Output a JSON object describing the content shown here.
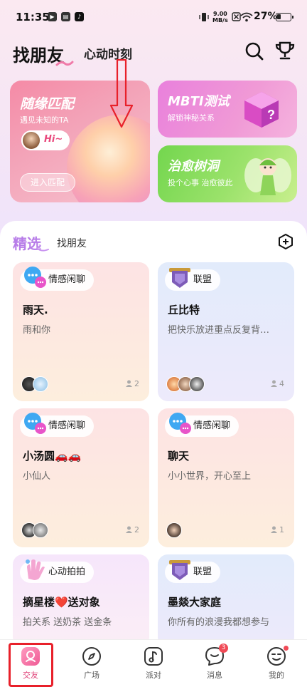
{
  "status_bar": {
    "time": "11:35",
    "speed_value": "9.00",
    "speed_unit": "MB/s",
    "battery": "27%"
  },
  "header": {
    "tab_active": "找朋友",
    "tab_other": "心动时刻"
  },
  "banners": {
    "match": {
      "title": "随缘匹配",
      "subtitle": "遇见未知的TA",
      "hi": "Hi~",
      "button": "进入匹配"
    },
    "mbti": {
      "title": "MBTI测试",
      "subtitle": "解锁神秘关系"
    },
    "tree": {
      "title": "治愈树洞",
      "subtitle": "投个心事 治愈彼此"
    }
  },
  "tabs": {
    "featured": "精选",
    "find_friends": "找朋友"
  },
  "rooms": [
    {
      "tag": "情感闲聊",
      "title": "雨天.",
      "desc": "雨和你",
      "members": "2"
    },
    {
      "tag": "联盟",
      "title": "丘比特",
      "desc": "把快乐放进重点反复背…",
      "members": "4"
    },
    {
      "tag": "情感闲聊",
      "title": "小汤圆🚗🚗",
      "desc": "小仙人",
      "members": "2"
    },
    {
      "tag": "情感闲聊",
      "title": "聊天",
      "desc": "小小世界，开心至上",
      "members": "1"
    },
    {
      "tag": "心动拍拍",
      "title": "摘星楼❤️送对象",
      "desc": "拍关系 送奶茶 送金条"
    },
    {
      "tag": "联盟",
      "title": "墨燚大家庭",
      "desc": "你所有的浪漫我都想参与"
    }
  ],
  "nav": {
    "items": [
      "交友",
      "广场",
      "派对",
      "消息",
      "我的"
    ],
    "message_badge": "3"
  },
  "colors": {
    "accent_pink": "#e0457b",
    "featured_purple": "#b77ce8",
    "annotation_red": "#e8202a"
  }
}
